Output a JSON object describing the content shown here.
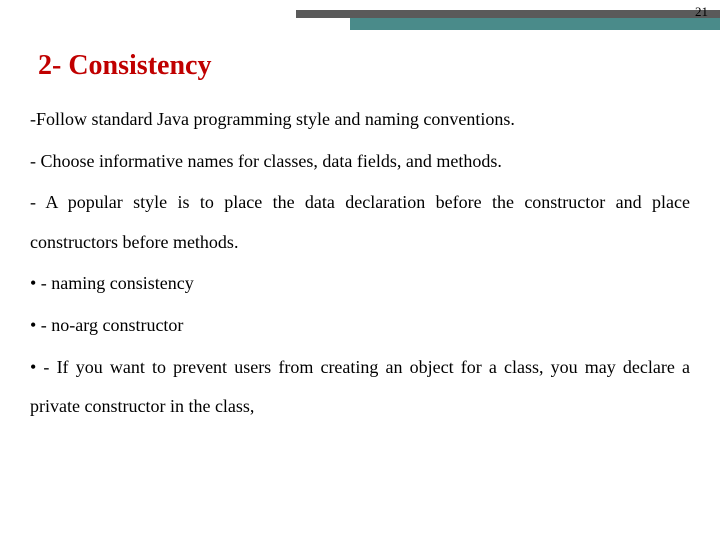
{
  "page_number": "21",
  "title": "2- Consistency",
  "paragraphs": {
    "p1": "-Follow standard Java programming style and naming conventions.",
    "p2": "- Choose informative names for classes, data fields, and methods.",
    "p3": "- A popular style is to place the data declaration before the constructor and place constructors before methods."
  },
  "bullets": {
    "b1": "• - naming consistency",
    "b2": "• - no-arg constructor",
    "b3": "• - If you want to prevent users from creating an object for a class, you may declare a private constructor in the class,"
  }
}
